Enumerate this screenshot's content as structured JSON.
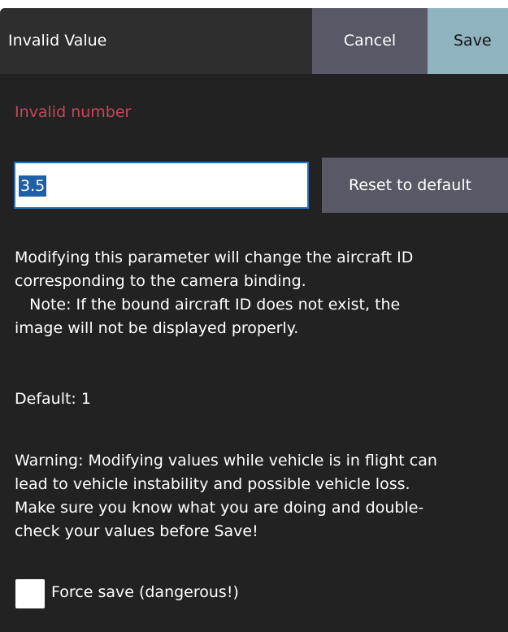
{
  "dialog": {
    "title": "Invalid Value",
    "cancel_label": "Cancel",
    "save_label": "Save"
  },
  "validation": {
    "error": "Invalid number"
  },
  "value_field": {
    "value": "3.5"
  },
  "reset_label": "Reset to default",
  "description": {
    "lines": [
      "Modifying this parameter will change the aircraft ID",
      "corresponding to the camera binding.",
      "   Note: If the bound aircraft ID does not exist, the",
      "image will not be displayed properly."
    ]
  },
  "default_text": "Default: 1",
  "warning": {
    "lines": [
      "Warning: Modifying values while vehicle is in flight can",
      "lead to vehicle instability and possible vehicle loss.",
      "Make sure you know what you are doing and double-",
      "check your values before Save!"
    ]
  },
  "force_save": {
    "label": "Force save (dangerous!)",
    "checked": false
  },
  "colors": {
    "background": "#222222",
    "header": "#2e2e2e",
    "button": "#585866",
    "save_button": "#8fb3bf",
    "error": "#c2485a",
    "selection": "#1f5fa8"
  }
}
